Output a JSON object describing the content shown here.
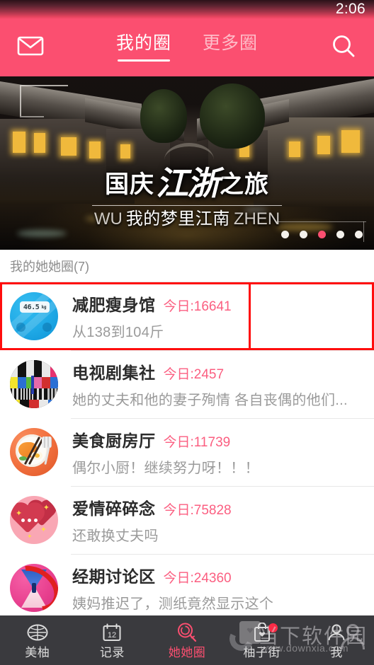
{
  "status": {
    "time": "2:06"
  },
  "header": {
    "mail_icon": "mail-icon",
    "search_icon": "search-icon",
    "tabs": [
      {
        "label": "我的圈",
        "active": true
      },
      {
        "label": "更多圈",
        "active": false
      }
    ]
  },
  "banner": {
    "title_prefix": "国庆",
    "title_script": "江浙",
    "title_suffix": "之旅",
    "sub_left": "WU",
    "sub_center": "我的梦里江南",
    "sub_right": "ZHEN",
    "dots_total": 5,
    "dots_active_index": 2,
    "active_dot_color": "#fb4f70"
  },
  "section": {
    "title": "我的她她圈(7)"
  },
  "list": {
    "highlight_color": "#ff0d0d",
    "count_color": "#fb5e80",
    "items": [
      {
        "title": "减肥瘦身馆",
        "count_label": "今日:16641",
        "subtitle": "从138到104斤",
        "avatar": "weight-scale-icon",
        "avatar_text": "46.5",
        "avatar_unit": "kg",
        "highlighted": true
      },
      {
        "title": "电视剧集社",
        "count_label": "今日:2457",
        "subtitle": "她的丈夫和他的妻子殉情 各自丧偶的他们...",
        "avatar": "tv-test-pattern-icon",
        "highlighted": false
      },
      {
        "title": "美食厨房厅",
        "count_label": "今日:11739",
        "subtitle": "偶尔小厨！继续努力呀！！！",
        "avatar": "food-plate-icon",
        "highlighted": false
      },
      {
        "title": "爱情碎碎念",
        "count_label": "今日:75828",
        "subtitle": "还敢换丈夫吗",
        "avatar": "heart-chat-icon",
        "highlighted": false
      },
      {
        "title": "经期讨论区",
        "count_label": "今日:24360",
        "subtitle": "姨妈推迟了，测纸竟然显示这个",
        "avatar": "hourglass-icon",
        "highlighted": false
      }
    ]
  },
  "tabbar": {
    "active_color": "#fb4f70",
    "items": [
      {
        "label": "美柚",
        "icon": "pomelo-icon",
        "active": false,
        "badge": false
      },
      {
        "label": "记录",
        "icon": "calendar-icon",
        "active": false,
        "badge": false
      },
      {
        "label": "她她圈",
        "icon": "lollipop-icon",
        "active": true,
        "badge": false
      },
      {
        "label": "柚子街",
        "icon": "shop-bag-icon",
        "active": false,
        "badge": true
      },
      {
        "label": "我",
        "icon": "person-icon",
        "active": false,
        "badge": false
      }
    ]
  },
  "watermark": {
    "cn": "当下软件园",
    "url": "www.downxia.com"
  }
}
